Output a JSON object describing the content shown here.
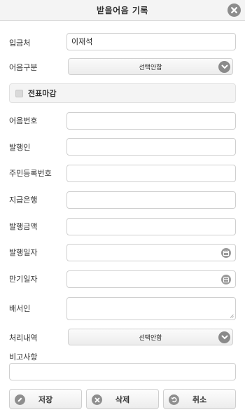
{
  "header": {
    "title": "받을어음 기록",
    "close_icon": "close-icon"
  },
  "fields": {
    "receiver": {
      "label": "입금처",
      "value": "이재석"
    },
    "bill_type": {
      "label": "어음구분",
      "selected": "선택안함"
    },
    "slip_close": {
      "label": "전표마감",
      "checked": false
    },
    "bill_number": {
      "label": "어음번호",
      "value": ""
    },
    "issuer": {
      "label": "발행인",
      "value": ""
    },
    "resident_number": {
      "label": "주민등록번호",
      "value": ""
    },
    "paying_bank": {
      "label": "지급은행",
      "value": ""
    },
    "amount": {
      "label": "발행금액",
      "value": ""
    },
    "issue_date": {
      "label": "발행일자",
      "value": ""
    },
    "due_date": {
      "label": "만기일자",
      "value": ""
    },
    "endorser": {
      "label": "배서인",
      "value": ""
    },
    "processing": {
      "label": "처리내역",
      "selected": "선택안함"
    },
    "remarks": {
      "label": "비고사항",
      "value": ""
    }
  },
  "buttons": {
    "save": {
      "label": "저장",
      "icon": "pencil-icon"
    },
    "delete": {
      "label": "삭제",
      "icon": "x-circle-icon"
    },
    "cancel": {
      "label": "취소",
      "icon": "undo-icon"
    }
  }
}
